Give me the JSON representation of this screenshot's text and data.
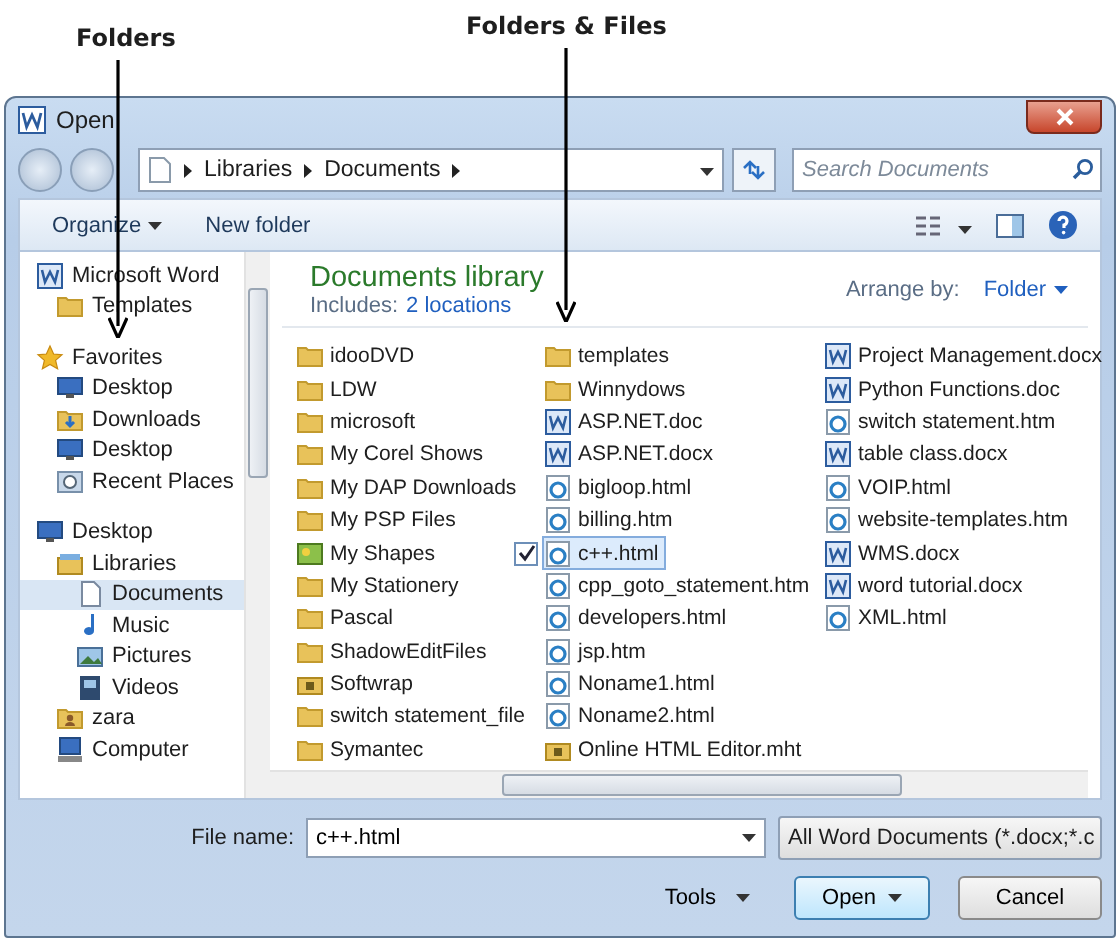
{
  "annotations": [
    {
      "label": "Folders"
    },
    {
      "label": "Folders & Files"
    }
  ],
  "window": {
    "title": "Open"
  },
  "address": {
    "crumbs": [
      "Libraries",
      "Documents"
    ],
    "search_placeholder": "Search Documents"
  },
  "toolbar": {
    "organize": "Organize",
    "new_folder": "New folder"
  },
  "sidebar": {
    "items": [
      {
        "label": "Microsoft Word",
        "kind": "word",
        "selected": false,
        "children": [
          {
            "label": "Templates",
            "kind": "folder",
            "selected": false
          }
        ]
      },
      {
        "label": "Favorites",
        "kind": "star",
        "selected": false,
        "children": [
          {
            "label": "Desktop",
            "kind": "desktop",
            "selected": false
          },
          {
            "label": "Downloads",
            "kind": "downloads",
            "selected": false
          },
          {
            "label": "Desktop",
            "kind": "desktop",
            "selected": false
          },
          {
            "label": "Recent Places",
            "kind": "recent",
            "selected": false
          }
        ]
      },
      {
        "label": "Desktop",
        "kind": "desktop",
        "selected": false,
        "children": [
          {
            "label": "Libraries",
            "kind": "libraries",
            "selected": false,
            "children": [
              {
                "label": "Documents",
                "kind": "document",
                "selected": true
              },
              {
                "label": "Music",
                "kind": "music",
                "selected": false
              },
              {
                "label": "Pictures",
                "kind": "pictures",
                "selected": false
              },
              {
                "label": "Videos",
                "kind": "videos",
                "selected": false
              }
            ]
          },
          {
            "label": "zara",
            "kind": "user",
            "selected": false
          },
          {
            "label": "Computer",
            "kind": "computer",
            "selected": false
          }
        ]
      }
    ]
  },
  "library": {
    "title": "Documents library",
    "includes_label": "Includes:",
    "includes_link": "2 locations",
    "arrange_label": "Arrange by:",
    "arrange_value": "Folder"
  },
  "files": [
    {
      "name": "idooDVD",
      "kind": "folder",
      "selected": false
    },
    {
      "name": "LDW",
      "kind": "folder",
      "selected": false
    },
    {
      "name": "microsoft",
      "kind": "folder",
      "selected": false
    },
    {
      "name": "My Corel Shows",
      "kind": "folder",
      "selected": false
    },
    {
      "name": "My DAP Downloads",
      "kind": "folder",
      "selected": false
    },
    {
      "name": "My PSP Files",
      "kind": "folder",
      "selected": false
    },
    {
      "name": "My Shapes",
      "kind": "shapes",
      "selected": false
    },
    {
      "name": "My Stationery",
      "kind": "folder",
      "selected": false
    },
    {
      "name": "Pascal",
      "kind": "folder",
      "selected": false
    },
    {
      "name": "ShadowEditFiles",
      "kind": "folder",
      "selected": false
    },
    {
      "name": "Softwrap",
      "kind": "locked",
      "selected": false
    },
    {
      "name": "switch statement_file",
      "kind": "folder",
      "selected": false
    },
    {
      "name": "Symantec",
      "kind": "folder",
      "selected": false
    },
    {
      "name": "templates",
      "kind": "folder",
      "selected": false
    },
    {
      "name": "Winnydows",
      "kind": "folder",
      "selected": false
    },
    {
      "name": "ASP.NET.doc",
      "kind": "word",
      "selected": false
    },
    {
      "name": "ASP.NET.docx",
      "kind": "word",
      "selected": false
    },
    {
      "name": "bigloop.html",
      "kind": "html",
      "selected": false
    },
    {
      "name": "billing.htm",
      "kind": "html",
      "selected": false
    },
    {
      "name": "c++.html",
      "kind": "html",
      "selected": true
    },
    {
      "name": "cpp_goto_statement.htm",
      "kind": "html",
      "selected": false
    },
    {
      "name": "developers.html",
      "kind": "html",
      "selected": false
    },
    {
      "name": "jsp.htm",
      "kind": "html",
      "selected": false
    },
    {
      "name": "Noname1.html",
      "kind": "html",
      "selected": false
    },
    {
      "name": "Noname2.html",
      "kind": "html",
      "selected": false
    },
    {
      "name": "Online HTML Editor.mht",
      "kind": "locked",
      "selected": false
    },
    {
      "name": "Project Management.docx",
      "kind": "word",
      "selected": false
    },
    {
      "name": "Python Functions.doc",
      "kind": "word",
      "selected": false
    },
    {
      "name": "switch statement.htm",
      "kind": "html",
      "selected": false
    },
    {
      "name": "table class.docx",
      "kind": "word",
      "selected": false
    },
    {
      "name": "VOIP.html",
      "kind": "html",
      "selected": false
    },
    {
      "name": "website-templates.htm",
      "kind": "html",
      "selected": false
    },
    {
      "name": "WMS.docx",
      "kind": "word",
      "selected": false
    },
    {
      "name": "word tutorial.docx",
      "kind": "word",
      "selected": false
    },
    {
      "name": "XML.html",
      "kind": "html",
      "selected": false
    }
  ],
  "footer": {
    "file_name_label": "File name:",
    "file_name_value": "c++.html",
    "filter": "All Word Documents (*.docx;*.c",
    "tools": "Tools",
    "open": "Open",
    "cancel": "Cancel"
  }
}
